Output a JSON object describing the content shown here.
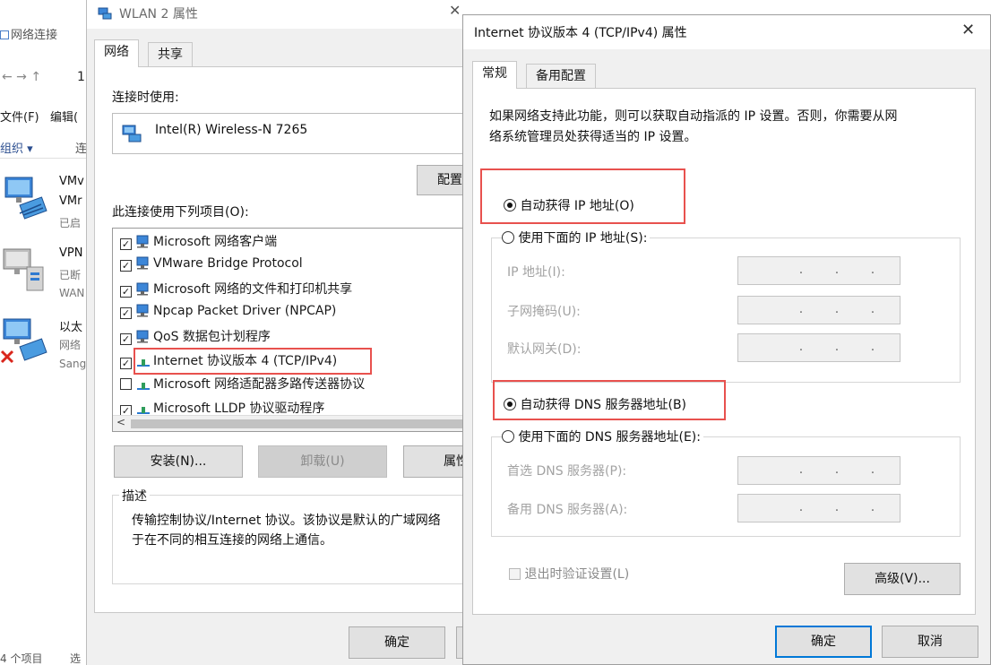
{
  "background_window": {
    "title": "网络连接",
    "nav_arrows": "←  →  ↑",
    "nav_crumb": "1",
    "menu_file": "文件(F)",
    "menu_edit": "编辑(",
    "toolbar_org": "组织 ▾",
    "toolbar_connect": "连",
    "items": [
      {
        "name1": "VMv",
        "name2": "VMr",
        "sub": "已启"
      },
      {
        "name1": "VPN",
        "sub1": "已断",
        "sub2": "WAN"
      },
      {
        "name1": "以太",
        "sub1": "网络",
        "sub2": "Sang"
      }
    ],
    "status_count": "4 个项目",
    "status_sel": "选"
  },
  "wlan_window": {
    "title": "WLAN 2 属性",
    "tabs": [
      "网络",
      "共享"
    ],
    "connect_using_label": "连接时使用:",
    "adapter_name": "Intel(R) Wireless-N 7265",
    "configure_button": "配置",
    "items_label": "此连接使用下列项目(O):",
    "items": [
      {
        "checked": true,
        "label": "Microsoft 网络客户端"
      },
      {
        "checked": true,
        "label": "VMware Bridge Protocol"
      },
      {
        "checked": true,
        "label": "Microsoft 网络的文件和打印机共享"
      },
      {
        "checked": true,
        "label": "Npcap Packet Driver (NPCAP)"
      },
      {
        "checked": true,
        "label": "QoS 数据包计划程序"
      },
      {
        "checked": true,
        "label": "Internet 协议版本 4 (TCP/IPv4)"
      },
      {
        "checked": false,
        "label": "Microsoft 网络适配器多路传送器协议"
      },
      {
        "checked": true,
        "label": "Microsoft LLDP 协议驱动程序"
      }
    ],
    "scroll_left": "<",
    "install_button": "安装(N)...",
    "uninstall_button": "卸载(U)",
    "properties_button": "属性",
    "description_legend": "描述",
    "description_line1": "传输控制协议/Internet 协议。该协议是默认的广域网络",
    "description_line2": "于在不同的相互连接的网络上通信。",
    "ok_button": "确定"
  },
  "ipv4_window": {
    "title": "Internet 协议版本 4 (TCP/IPv4) 属性",
    "close_glyph": "✕",
    "tabs": [
      "常规",
      "备用配置"
    ],
    "intro_line1": "如果网络支持此功能，则可以获取自动指派的 IP 设置。否则，你需要从网",
    "intro_line2": "络系统管理员处获得适当的 IP 设置。",
    "auto_ip_label": "自动获得 IP 地址(O)",
    "auto_ip_selected": true,
    "manual_ip_label": "使用下面的 IP 地址(S):",
    "ip_address_label": "IP 地址(I):",
    "subnet_label": "子网掩码(U):",
    "gateway_label": "默认网关(D):",
    "auto_dns_label": "自动获得 DNS 服务器地址(B)",
    "auto_dns_selected": true,
    "manual_dns_label": "使用下面的 DNS 服务器地址(E):",
    "preferred_dns_label": "首选 DNS 服务器(P):",
    "alternate_dns_label": "备用 DNS 服务器(A):",
    "ip_dots": ".",
    "validate_label": "退出时验证设置(L)",
    "advanced_button": "高级(V)...",
    "ok_button": "确定",
    "cancel_button": "取消"
  },
  "colors": {
    "highlight_red": "#e8514e",
    "focus_blue": "#0078d7",
    "window_bg": "#f0f0f0"
  }
}
